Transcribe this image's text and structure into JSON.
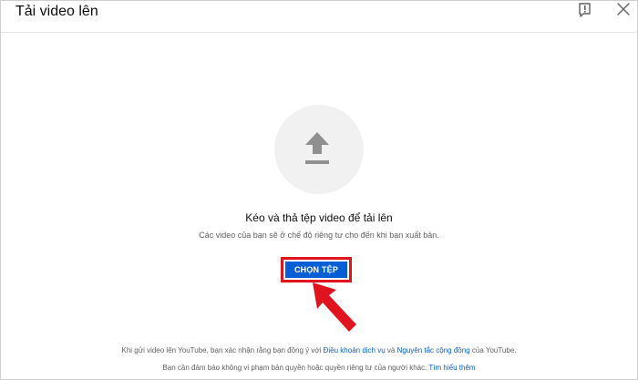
{
  "dialog": {
    "title": "Tải video lên",
    "icons": {
      "feedback": "feedback-flag-icon",
      "close": "close-icon",
      "upload": "upload-arrow-icon"
    }
  },
  "dropzone": {
    "main_text": "Kéo và thả tệp video để tải lên",
    "sub_text": "Các video của bạn sẽ ở chế độ riêng tư cho đến khi bạn xuất bản."
  },
  "select_button": {
    "label": "CHỌN TỆP"
  },
  "footer": {
    "line1_prefix": "Khi gửi video lên YouTube, bạn xác nhận rằng bạn đồng ý với ",
    "terms_link": "Điều khoản dịch vụ",
    "line1_middle": " và ",
    "guidelines_link": "Nguyên tắc cộng đồng",
    "line1_suffix": " của YouTube.",
    "line2_prefix": "Bạn cần đảm bảo không vi phạm bản quyền hoặc quyền riêng tư của người khác. ",
    "learn_more_link": "Tìm hiểu thêm"
  },
  "colors": {
    "accent": "#065fd4",
    "highlight": "#e0141e",
    "circle_bg": "#f1f1f1",
    "icon_gray": "#909090"
  }
}
